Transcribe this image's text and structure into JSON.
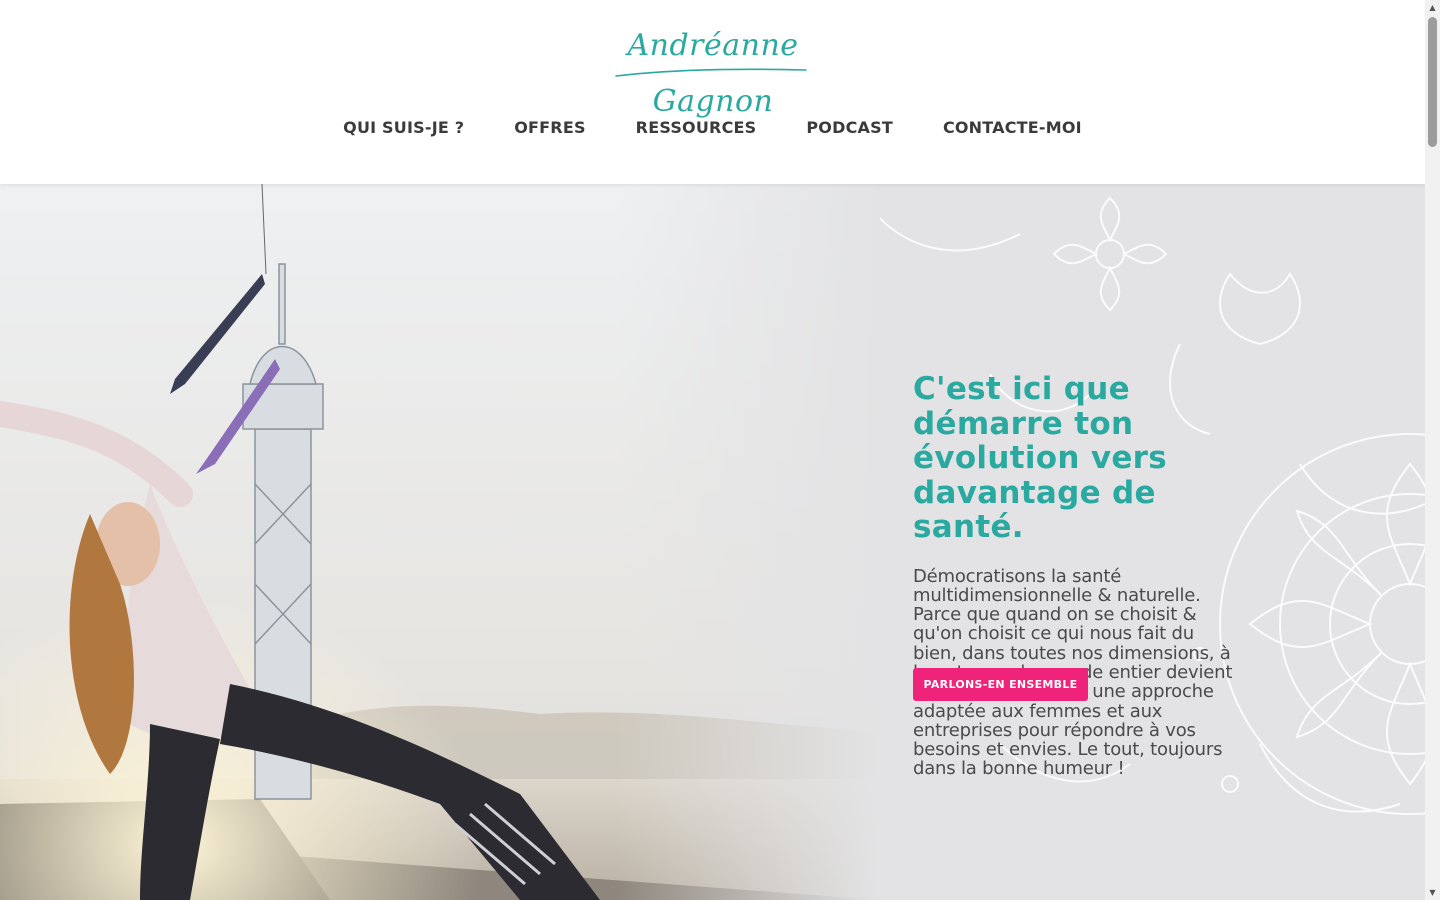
{
  "header": {
    "logo_text": "Andréanne Gagnon",
    "nav": [
      {
        "label": "QUI SUIS-JE ?"
      },
      {
        "label": "OFFRES"
      },
      {
        "label": "RESSOURCES"
      },
      {
        "label": "PODCAST"
      },
      {
        "label": "CONTACTE-MOI"
      }
    ]
  },
  "hero": {
    "title": "C'est ici que démarre ton évolution vers davantage de santé.",
    "text": "Démocratisons la santé multidimensionnelle & naturelle. Parce que quand on se choisit & qu'on choisit ce qui nous fait du bien, dans toutes nos dimensions, à long terme, le monde entier devient meilleur. Je propose une approche adaptée aux femmes et aux entreprises pour répondre à vos besoins et envies. Le tout, toujours dans la bonne humeur !",
    "cta_label": "PARLONS-EN ENSEMBLE"
  },
  "colors": {
    "brand_teal": "#2aa9a0",
    "cta_pink": "#f0237a",
    "hero_bg": "#e3e3e5"
  },
  "icons": {
    "scroll_up": "▲",
    "scroll_down": "▼"
  }
}
